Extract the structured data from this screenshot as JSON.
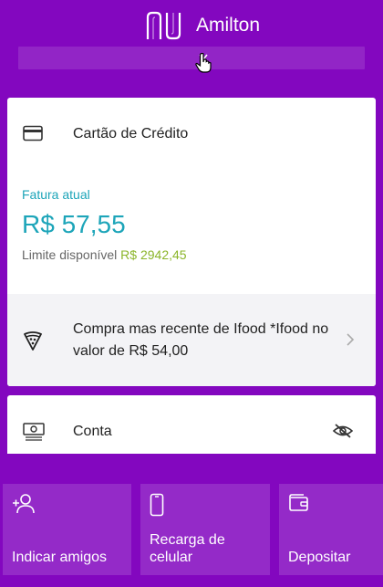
{
  "header": {
    "user_name": "Amilton",
    "logo_icon": "nubank-logo",
    "collapse_icon": "chevron-down-icon"
  },
  "credit_card": {
    "title": "Cartão de Crédito",
    "icon": "credit-card-icon",
    "fatura_label": "Fatura atual",
    "fatura_value": "R$ 57,55",
    "limite_label": "Limite disponível",
    "limite_value": "R$ 2942,45",
    "recent_purchase": {
      "icon": "pizza-icon",
      "text": "Compra mas recente de Ifood *Ifood no valor de R$ 54,00"
    }
  },
  "account": {
    "title": "Conta",
    "icon": "money-icon",
    "visibility_icon": "eye-off-icon"
  },
  "actions": [
    {
      "label": "Indicar amigos",
      "icon": "add-user-icon"
    },
    {
      "label": "Recarga de celular",
      "icon": "phone-icon"
    },
    {
      "label": "Depositar",
      "icon": "wallet-icon"
    }
  ],
  "colors": {
    "background": "#8307bf",
    "accent_teal": "#1da5b9",
    "limit_green": "#8bb52a"
  }
}
